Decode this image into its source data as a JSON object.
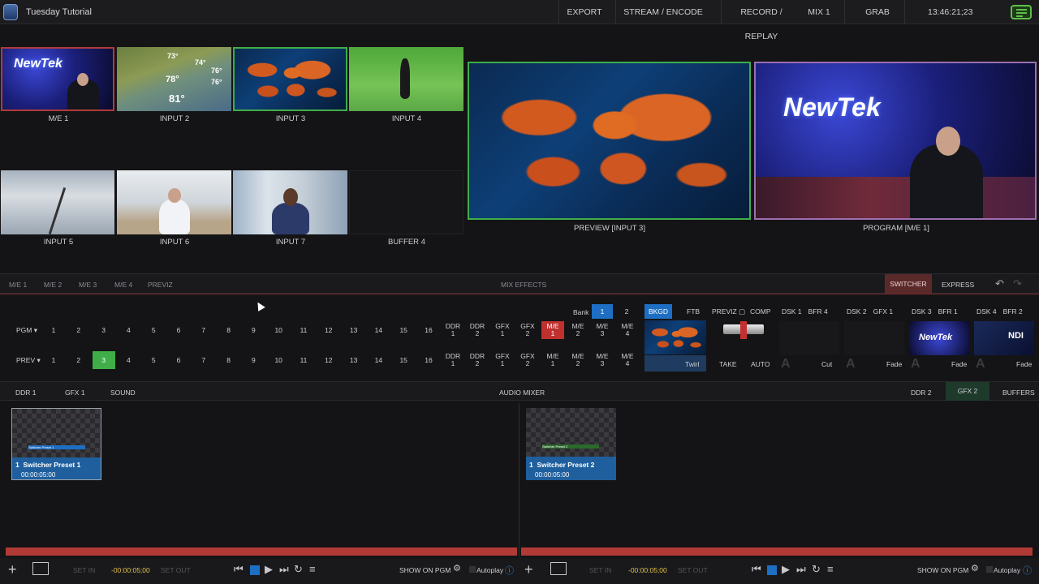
{
  "topbar": {
    "title": "Tuesday Tutorial",
    "export": "EXPORT",
    "stream": "STREAM / ENCODE",
    "record": "RECORD / REPLAY",
    "mix": "MIX 1",
    "grab": "GRAB",
    "clock": "13:46:21;23"
  },
  "monitors": {
    "me1": "M/E 1",
    "input2": "INPUT 2",
    "input3": "INPUT 3",
    "input4": "INPUT 4",
    "input5": "INPUT 5",
    "input6": "INPUT 6",
    "input7": "INPUT 7",
    "buffer4": "BUFFER 4",
    "preview": "PREVIEW [INPUT 3]",
    "program": "PROGRAM [M/E 1]",
    "brand": "NewTek",
    "weather_temps": [
      "73°",
      "74°",
      "78°",
      "76°",
      "76°",
      "81°"
    ]
  },
  "mixbar": {
    "tabs": [
      "M/E 1",
      "M/E 2",
      "M/E 3",
      "M/E 4",
      "PREVIZ"
    ],
    "title": "MIX EFFECTS",
    "switcher": "SWITCHER",
    "express": "EXPRESS"
  },
  "switcher": {
    "bank_label": "Bank",
    "banks": [
      "1",
      "2"
    ],
    "pgm_label": "PGM",
    "prev_label": "PREV",
    "numbers": [
      "1",
      "2",
      "3",
      "4",
      "5",
      "6",
      "7",
      "8",
      "9",
      "10",
      "11",
      "12",
      "13",
      "14",
      "15",
      "16"
    ],
    "sources": [
      [
        "DDR",
        "1"
      ],
      [
        "DDR",
        "2"
      ],
      [
        "GFX",
        "1"
      ],
      [
        "GFX",
        "2"
      ],
      [
        "M/E",
        "1"
      ],
      [
        "M/E",
        "2"
      ],
      [
        "M/E",
        "3"
      ],
      [
        "M/E",
        "4"
      ]
    ],
    "pgm_active": "M/E 1",
    "prev_active": "3",
    "bkgd": "BKGD",
    "ftb": "FTB",
    "twirl": "Twirl",
    "previz": "PREVIZ",
    "comp": "COMP",
    "take": "TAKE",
    "auto": "AUTO",
    "dsk": [
      {
        "name": "DSK 1",
        "src": "BFR 4",
        "trans": "Cut"
      },
      {
        "name": "DSK 2",
        "src": "GFX 1",
        "trans": "Fade"
      },
      {
        "name": "DSK 3",
        "src": "BFR 1",
        "trans": "Fade"
      },
      {
        "name": "DSK 4",
        "src": "BFR 2",
        "trans": "Fade"
      }
    ],
    "ndi": "NDI"
  },
  "lowerbar": {
    "tabs_left": [
      "DDR 1",
      "GFX 1",
      "SOUND"
    ],
    "center": "AUDIO MIXER",
    "tabs_right": [
      "DDR 2",
      "GFX 2",
      "BUFFERS"
    ]
  },
  "presets": [
    {
      "num": "1",
      "name": "Switcher Preset 1",
      "dur": "00:00:05:00",
      "thumb_text": "Switcher Preset 1"
    },
    {
      "num": "1",
      "name": "Switcher Preset 2",
      "dur": "00:00:05:00",
      "thumb_text": "Switcher Preset 2"
    }
  ],
  "transport": {
    "set_in": "SET IN",
    "set_out": "SET OUT",
    "time": "-00:00:05;00",
    "show_on_pgm": "SHOW ON PGM",
    "autoplay": "Autoplay"
  },
  "colors": {
    "accent_blue": "#1e6fc4",
    "pgm_red": "#c0302e",
    "prev_green": "#3fae49"
  }
}
